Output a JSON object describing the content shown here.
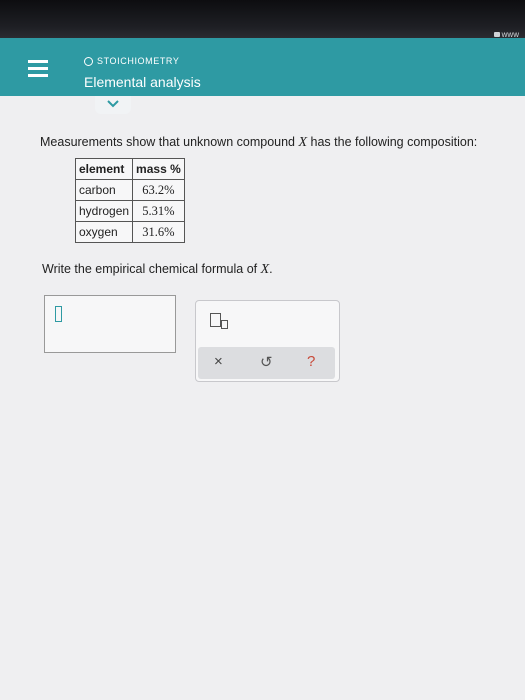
{
  "browser": {
    "url": "www"
  },
  "header": {
    "topic": "STOICHIOMETRY",
    "title": "Elemental analysis"
  },
  "question": {
    "text_before": "Measurements show that unknown compound ",
    "variable": "X",
    "text_after": " has the following composition:",
    "table": {
      "headers": [
        "element",
        "mass %"
      ],
      "rows": [
        {
          "element": "carbon",
          "mass": "63.2%"
        },
        {
          "element": "hydrogen",
          "mass": "5.31%"
        },
        {
          "element": "oxygen",
          "mass": "31.6%"
        }
      ]
    },
    "prompt_before": "Write the empirical chemical formula of ",
    "prompt_variable": "X",
    "prompt_after": "."
  },
  "answer": {
    "value": ""
  },
  "palette": {
    "icons": [
      "subscript-icon"
    ],
    "buttons": {
      "clear": "×",
      "undo": "↺",
      "help": "?"
    }
  },
  "colors": {
    "accent": "#2e9aa3",
    "help": "#c84a3a"
  }
}
